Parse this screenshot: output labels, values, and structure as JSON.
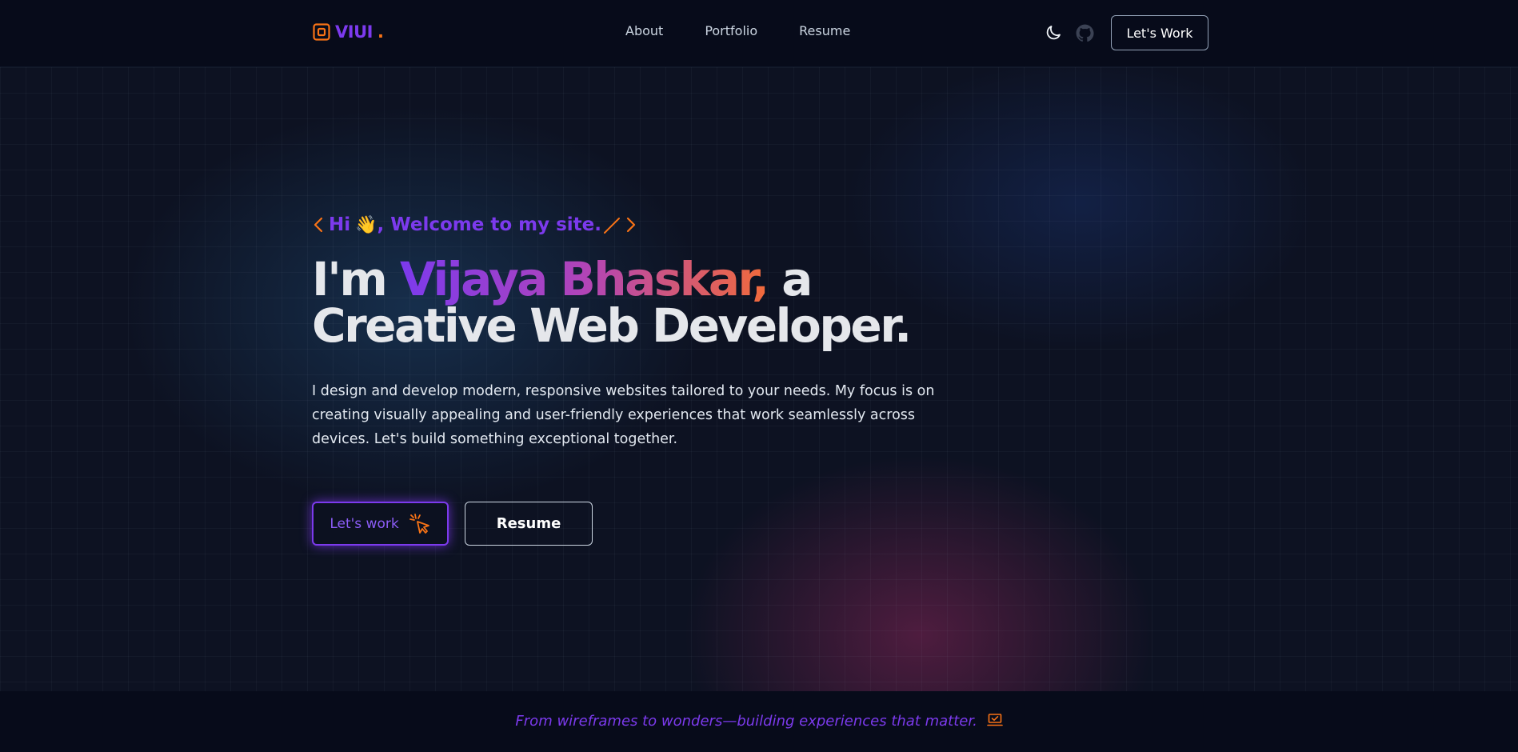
{
  "brand": {
    "name": "VIUI",
    "dot": "."
  },
  "nav": {
    "items": [
      {
        "label": "About"
      },
      {
        "label": "Portfolio"
      },
      {
        "label": "Resume"
      }
    ]
  },
  "header": {
    "cta_label": "Let's Work"
  },
  "hero": {
    "welcome": {
      "open": "<",
      "prefix": "Hi",
      "emoji": "👋",
      "text": ", Welcome to my site.",
      "slash": "/",
      "close": ">"
    },
    "headline": {
      "intro": "I'm ",
      "name": "Vijaya Bhaskar,",
      "after": " a",
      "line2": "Creative Web Developer."
    },
    "description": "I design and develop modern, responsive websites tailored to your needs. My focus is on creating visually appealing and user-friendly experiences that work seamlessly across devices. Let's build something exceptional together.",
    "primary_button": "Let's work",
    "secondary_button": "Resume"
  },
  "footer": {
    "tagline": "From wireframes to wonders—building experiences that matter."
  },
  "colors": {
    "accent_purple": "#7c3aed",
    "accent_orange": "#f97316",
    "background": "#0d1222",
    "header_bg": "#070b1a"
  },
  "icons": {
    "logo": "square-logo-icon",
    "theme": "moon-icon",
    "github": "github-icon",
    "cursor": "cursor-click-icon",
    "footer": "laptop-check-icon"
  }
}
